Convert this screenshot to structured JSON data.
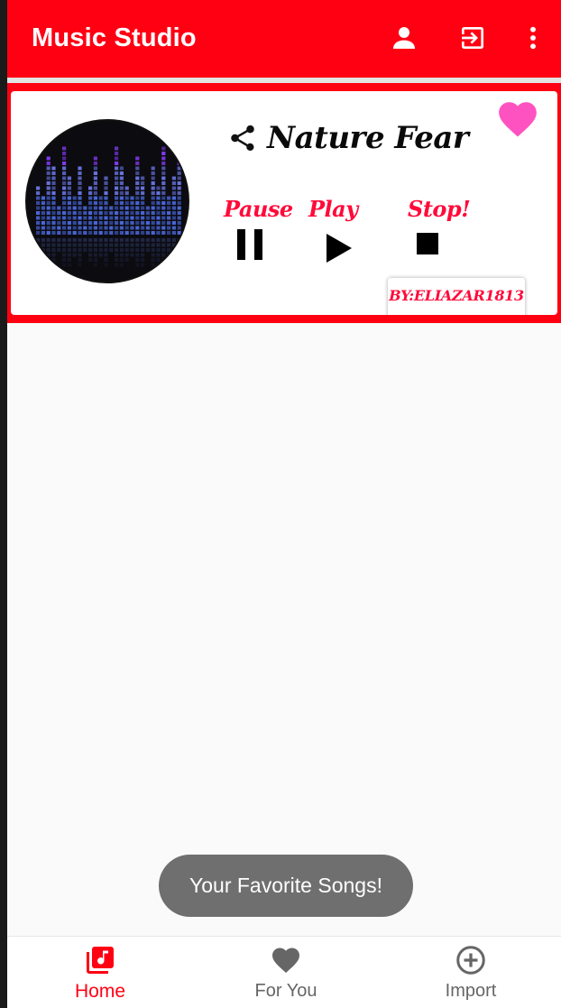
{
  "app_bar": {
    "title": "Music Studio",
    "icons": [
      "profile-icon",
      "exit-icon",
      "more-vert-icon"
    ],
    "color": "#ff0013"
  },
  "song_card": {
    "title": "Nature Fear",
    "controls": {
      "pause_label": "Pause",
      "play_label": "Play",
      "stop_label": "Stop!"
    },
    "author": "BY:ELIAZAR1813",
    "favorite_color": "#ff52c1",
    "label_color": "#ff0a3a"
  },
  "toast": {
    "message": "Your Favorite Songs!"
  },
  "bottom_nav": {
    "items": [
      {
        "label": "Home",
        "icon": "music-library-icon",
        "active": true
      },
      {
        "label": "For You",
        "icon": "heart-icon",
        "active": false
      },
      {
        "label": "Import",
        "icon": "add-circle-icon",
        "active": false
      }
    ],
    "active_color": "#ff0013",
    "inactive_color": "#666666"
  }
}
